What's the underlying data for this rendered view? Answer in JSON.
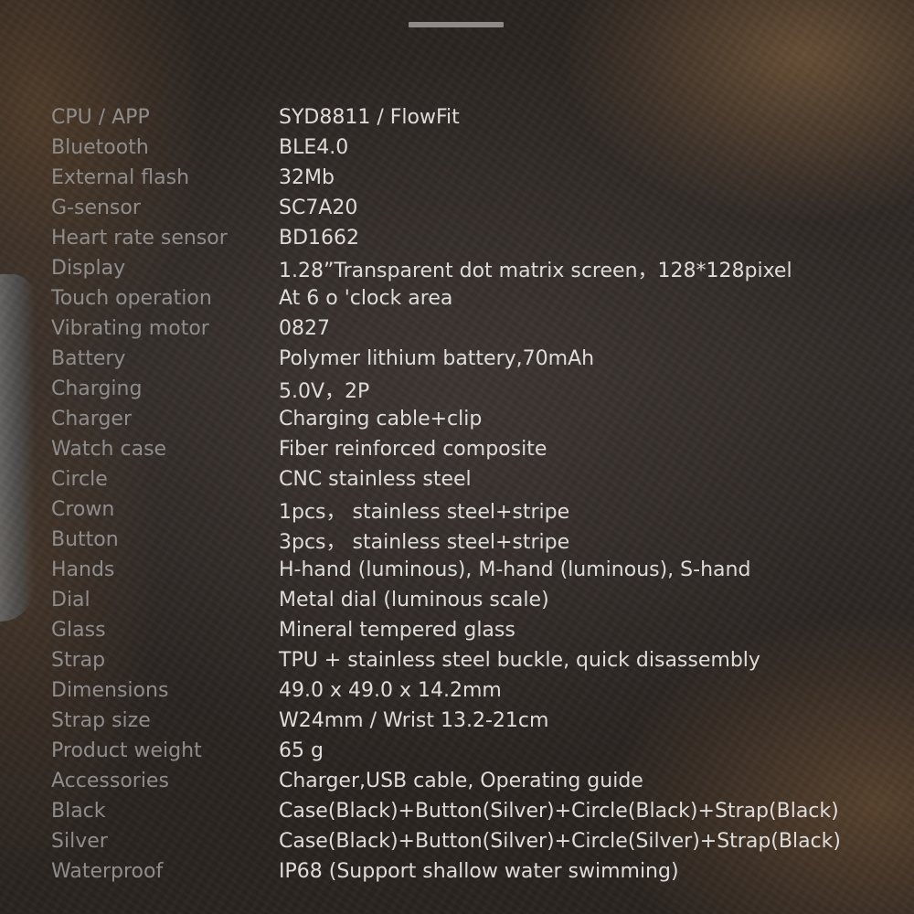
{
  "specs": [
    {
      "label": "CPU / APP",
      "value": "SYD8811 / FlowFit"
    },
    {
      "label": "Bluetooth",
      "value": "BLE4.0"
    },
    {
      "label": "External flash",
      "value": "32Mb"
    },
    {
      "label": "G-sensor",
      "value": "SC7A20"
    },
    {
      "label": "Heart rate sensor",
      "value": "BD1662"
    },
    {
      "label": "Display",
      "value": "1.28”Transparent dot matrix screen，128*128pixel"
    },
    {
      "label": "Touch operation",
      "value": "At 6 o 'clock area"
    },
    {
      "label": "Vibrating motor",
      "value": "0827"
    },
    {
      "label": "Battery",
      "value": "Polymer lithium battery,70mAh"
    },
    {
      "label": "Charging",
      "value": "5.0V，2P"
    },
    {
      "label": "Charger",
      "value": "Charging cable+clip"
    },
    {
      "label": "Watch case",
      "value": "Fiber reinforced composite"
    },
    {
      "label": "Circle",
      "value": "CNC stainless steel"
    },
    {
      "label": "Crown",
      "value": "1pcs，  stainless steel+stripe"
    },
    {
      "label": "Button",
      "value": "3pcs，  stainless steel+stripe"
    },
    {
      "label": "Hands",
      "value": "H-hand (luminous), M-hand (luminous), S-hand"
    },
    {
      "label": "Dial",
      "value": "Metal dial (luminous scale)"
    },
    {
      "label": "Glass",
      "value": "Mineral tempered glass"
    },
    {
      "label": "Strap",
      "value": "TPU + stainless steel buckle, quick disassembly"
    },
    {
      "label": "Dimensions",
      "value": "49.0 x 49.0 x 14.2mm"
    },
    {
      "label": "Strap size",
      "value": "W24mm / Wrist 13.2-21cm"
    },
    {
      "label": "Product weight",
      "value": "65 g"
    },
    {
      "label": "Accessories",
      "value": "Charger,USB cable, Operating guide"
    },
    {
      "label": "Black",
      "value": "Case(Black)+Button(Silver)+Circle(Black)+Strap(Black)"
    },
    {
      "label": "Silver",
      "value": "Case(Black)+Button(Silver)+Circle(Silver)+Strap(Black)"
    },
    {
      "label": "Waterproof",
      "value": "IP68 (Support shallow water swimming)"
    }
  ]
}
